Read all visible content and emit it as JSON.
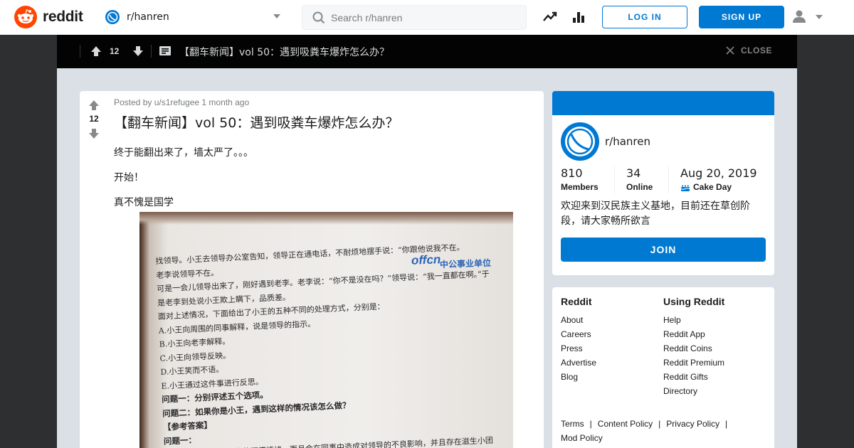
{
  "header": {
    "logo_text": "reddit",
    "community": "r/hanren",
    "search_placeholder": "Search r/hanren",
    "login_label": "LOG IN",
    "signup_label": "SIGN UP",
    "icons": [
      "popular-trend-icon",
      "stats-icon",
      "user-icon",
      "chevron-down-icon"
    ]
  },
  "postbar": {
    "score": "12",
    "title": "【翻车新闻】vol 50：遇到吸粪车爆炸怎么办？",
    "close_label": "CLOSE"
  },
  "post": {
    "meta": "Posted by u/s1refugee 1 month ago",
    "score": "12",
    "title": "【翻车新闻】vol 50：遇到吸粪车爆炸怎么办？",
    "paragraphs": [
      "终于能翻出来了，墙太严了。。。",
      "开始！",
      "真不愧是国学"
    ],
    "image": {
      "logo": "offcn",
      "logo_sub": "中公事业单位",
      "lines": [
        "找领导。小王去领导办公室告知，领导正在通电话，不耐烦地摆手说：“你跟他说我不在。",
        "老李说领导不在。",
        "     可是一会儿领导出来了，刚好遇到老李。老李说：“你不是没在吗？”领导说：“我一直都在啊。”于",
        "是老李到处说小王欺上瞒下，品质差。",
        "     面对上述情况，下面给出了小王的五种不同的处理方式，分别是：",
        "A.小王向周围的同事解释，说是领导的指示。",
        "B.小王向老李解释。",
        "C.小王向领导反映。",
        "D.小王笑而不语。",
        "E.小王通过这件事进行反思。",
        "问题一：分别评述五个选项。",
        "问题二：如果你是小王，遇到这样的情况该怎么做？",
        "【参考答案】",
        "问题一：",
        "A 项非但不能解决老李的不满情绪，而且会在同事中造成对领导的不良影响，并且存在滋生小团"
      ]
    }
  },
  "about": {
    "name": "r/hanren",
    "members_value": "810",
    "members_label": "Members",
    "online_value": "34",
    "online_label": "Online",
    "cakeday_value": "Aug 20, 2019",
    "cakeday_label": "Cake Day",
    "description": "欢迎来到汉民族主义基地，目前还在草创阶段，请大家畅所欲言",
    "join_label": "JOIN"
  },
  "footer": {
    "col1_title": "Reddit",
    "col1_links": [
      "About",
      "Careers",
      "Press",
      "Advertise",
      "Blog"
    ],
    "col2_title": "Using Reddit",
    "col2_links": [
      "Help",
      "Reddit App",
      "Reddit Coins",
      "Reddit Premium",
      "Reddit Gifts",
      "Directory"
    ],
    "policy_links": [
      "Terms",
      "Content Policy",
      "Privacy Policy",
      "Mod Policy"
    ]
  },
  "colors": {
    "brand_orange": "#ff4500",
    "accent_blue": "#0079d3",
    "page_bg": "#dae0e6",
    "overlay_bg": "#2e2f30"
  }
}
